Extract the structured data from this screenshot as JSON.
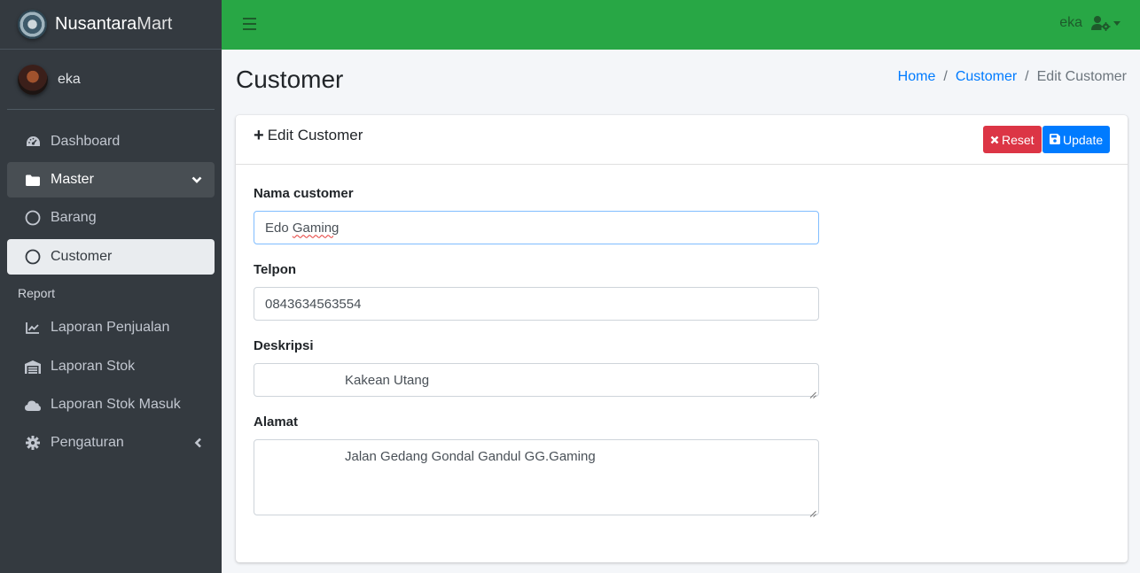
{
  "brand": {
    "name_bold": "Nusantara",
    "name_light": "Mart"
  },
  "user": {
    "name": "eka"
  },
  "sidebar": {
    "items": [
      {
        "label": "Dashboard",
        "icon": "tachometer-icon"
      },
      {
        "label": "Master",
        "icon": "folder-icon"
      },
      {
        "label": "Barang",
        "icon": "circle-icon"
      },
      {
        "label": "Customer",
        "icon": "circle-icon"
      }
    ],
    "report_header": "Report",
    "report_items": [
      {
        "label": "Laporan Penjualan",
        "icon": "chart-line-icon"
      },
      {
        "label": "Laporan Stok",
        "icon": "warehouse-icon"
      },
      {
        "label": "Laporan Stok Masuk",
        "icon": "cloud-icon"
      },
      {
        "label": "Pengaturan",
        "icon": "gear-icon"
      }
    ]
  },
  "topbar": {
    "user": "eka"
  },
  "page": {
    "title": "Customer",
    "breadcrumb": {
      "home": "Home",
      "section": "Customer",
      "current": "Edit Customer"
    }
  },
  "card": {
    "title": "Edit Customer",
    "reset_label": "Reset",
    "update_label": "Update"
  },
  "form": {
    "nama_label": "Nama customer",
    "nama_value": "Edo Gaming",
    "nama_first": "Edo",
    "nama_second": "Gaming",
    "telpon_label": "Telpon",
    "telpon_value": "0843634563554",
    "deskripsi_label": "Deskripsi",
    "deskripsi_value": "Kakean Utang",
    "alamat_label": "Alamat",
    "alamat_value": "Jalan Gedang Gondal Gandul GG.Gaming"
  },
  "colors": {
    "sidebar": "#343a40",
    "topbar": "#28a745",
    "primary": "#007bff",
    "danger": "#dc3545"
  }
}
